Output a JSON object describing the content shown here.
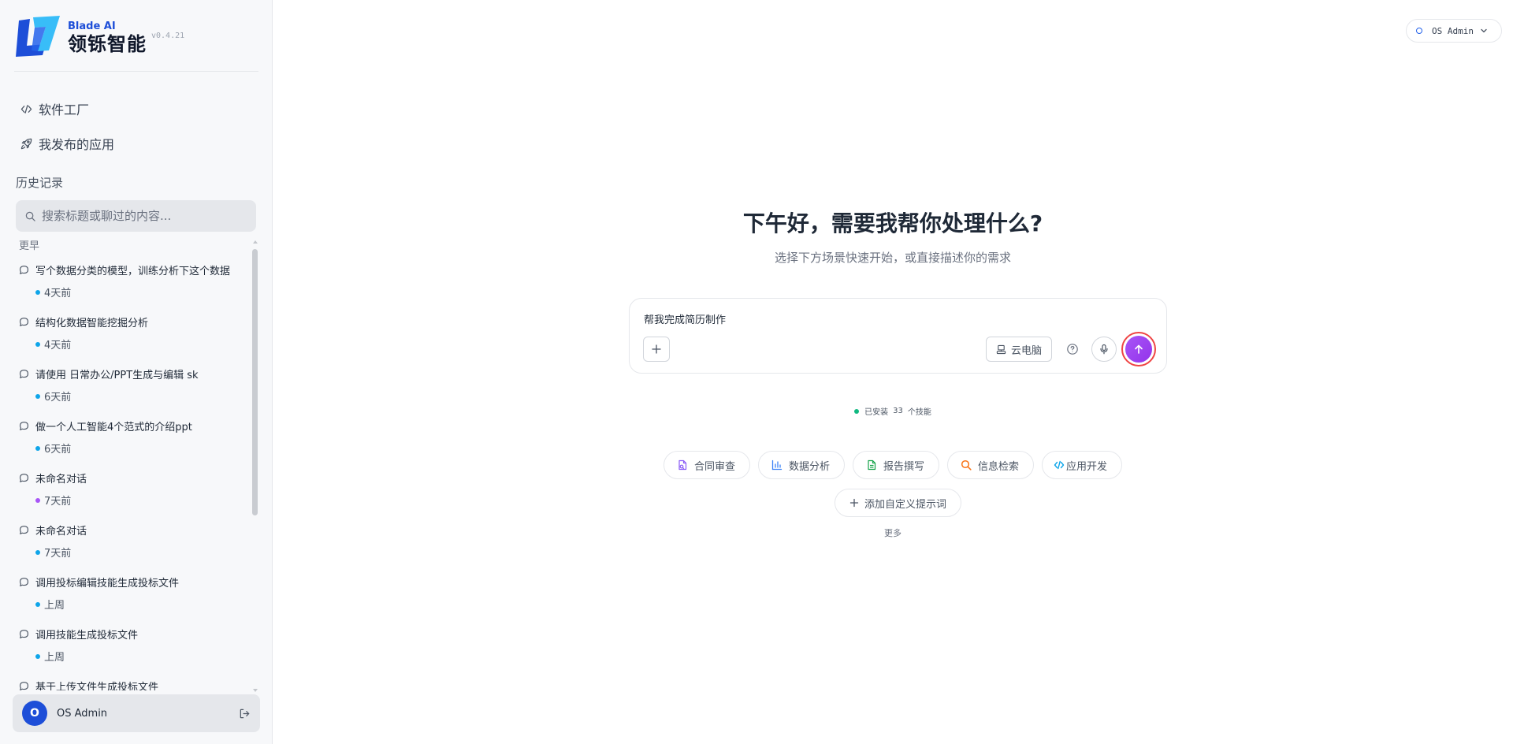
{
  "brand": {
    "name_en": "Blade AI",
    "name_cn": "领铄智能",
    "version": "v0.4.21"
  },
  "nav": {
    "software_factory": "软件工厂",
    "published_apps": "我发布的应用"
  },
  "history": {
    "title": "历史记录",
    "search_placeholder": "搜索标题或聊过的内容...",
    "group_label": "更早",
    "items": [
      {
        "title": "写个数据分类的模型，训练分析下这个数据",
        "time": "4天前",
        "dot_color": "#0ea5e9"
      },
      {
        "title": "结构化数据智能挖掘分析",
        "time": "4天前",
        "dot_color": "#0ea5e9"
      },
      {
        "title": "请使用 日常办公/PPT生成与编辑 sk",
        "time": "6天前",
        "dot_color": "#0ea5e9"
      },
      {
        "title": "做一个人工智能4个范式的介绍ppt",
        "time": "6天前",
        "dot_color": "#0ea5e9"
      },
      {
        "title": "未命名对话",
        "time": "7天前",
        "dot_color": "#a855f7"
      },
      {
        "title": "未命名对话",
        "time": "7天前",
        "dot_color": "#0ea5e9"
      },
      {
        "title": "调用投标编辑技能生成投标文件",
        "time": "上周",
        "dot_color": "#0ea5e9"
      },
      {
        "title": "调用技能生成投标文件",
        "time": "上周",
        "dot_color": "#0ea5e9"
      },
      {
        "title": "基于上传文件生成投标文件",
        "time": "",
        "dot_color": "#0ea5e9"
      }
    ]
  },
  "user": {
    "initial": "O",
    "name": "OS Admin"
  },
  "top_user": {
    "name": "OS Admin"
  },
  "main": {
    "greeting": "下午好，需要我帮你处理什么?",
    "subtitle": "选择下方场景快速开始，或直接描述你的需求",
    "composer_value": "帮我完成简历制作",
    "cloud_pc_label": "云电脑",
    "skills_prefix": "已安装",
    "skills_count": "33",
    "skills_suffix": "个技能",
    "chips": {
      "contract": "合同审查",
      "data": "数据分析",
      "report": "报告撰写",
      "search": "信息检索",
      "dev": "应用开发"
    },
    "add_prompt": "添加自定义提示词",
    "more": "更多"
  },
  "colors": {
    "accent_purple": "#9333ea",
    "brand_blue": "#1d4ed8",
    "highlight_red": "#ef4444",
    "status_green": "#10b981"
  }
}
